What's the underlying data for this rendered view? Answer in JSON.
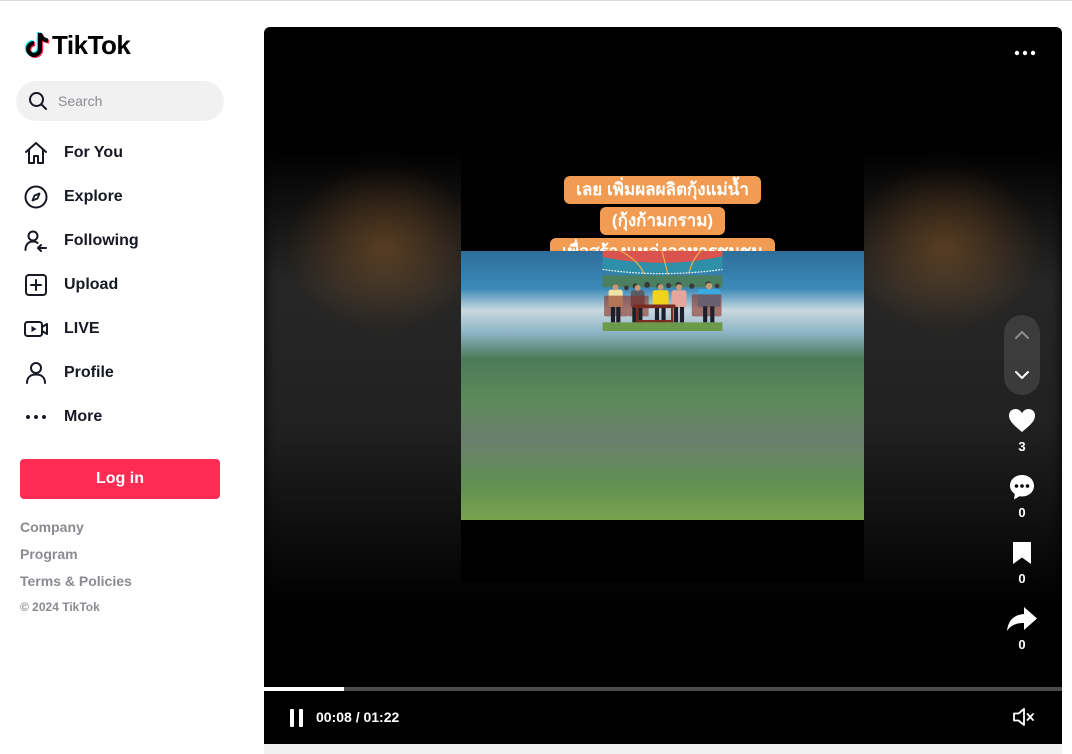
{
  "app": {
    "brand": "TikTok",
    "colors": {
      "accent": "#fe2c55",
      "caption_bg": "#f29b52",
      "muted": "#8a8b91"
    }
  },
  "search": {
    "placeholder": "Search",
    "icon": "search-icon"
  },
  "nav": {
    "items": [
      {
        "label": "For You",
        "icon": "home-icon"
      },
      {
        "label": "Explore",
        "icon": "compass-icon"
      },
      {
        "label": "Following",
        "icon": "following-icon"
      },
      {
        "label": "Upload",
        "icon": "plus-square-icon"
      },
      {
        "label": "LIVE",
        "icon": "live-icon"
      },
      {
        "label": "Profile",
        "icon": "person-icon"
      },
      {
        "label": "More",
        "icon": "more-dots-icon"
      }
    ]
  },
  "login": {
    "label": "Log in"
  },
  "footer": {
    "links": [
      "Company",
      "Program",
      "Terms & Policies"
    ],
    "copyright": "© 2024 TikTok"
  },
  "video": {
    "caption_lines": [
      "เลย เพิ่มผลผลิตกุ้งแม่น้ำ",
      "(กุ้งก้ามกราม)",
      "เพื่อสร้างแหล่งอาหารชุมชน"
    ],
    "time_display": "00:08 / 01:22",
    "progress_fraction": 0.1,
    "actions": [
      {
        "icon": "heart-icon",
        "count": "3"
      },
      {
        "icon": "comment-icon",
        "count": "0"
      },
      {
        "icon": "bookmark-icon",
        "count": "0"
      },
      {
        "icon": "share-icon",
        "count": "0"
      }
    ]
  }
}
